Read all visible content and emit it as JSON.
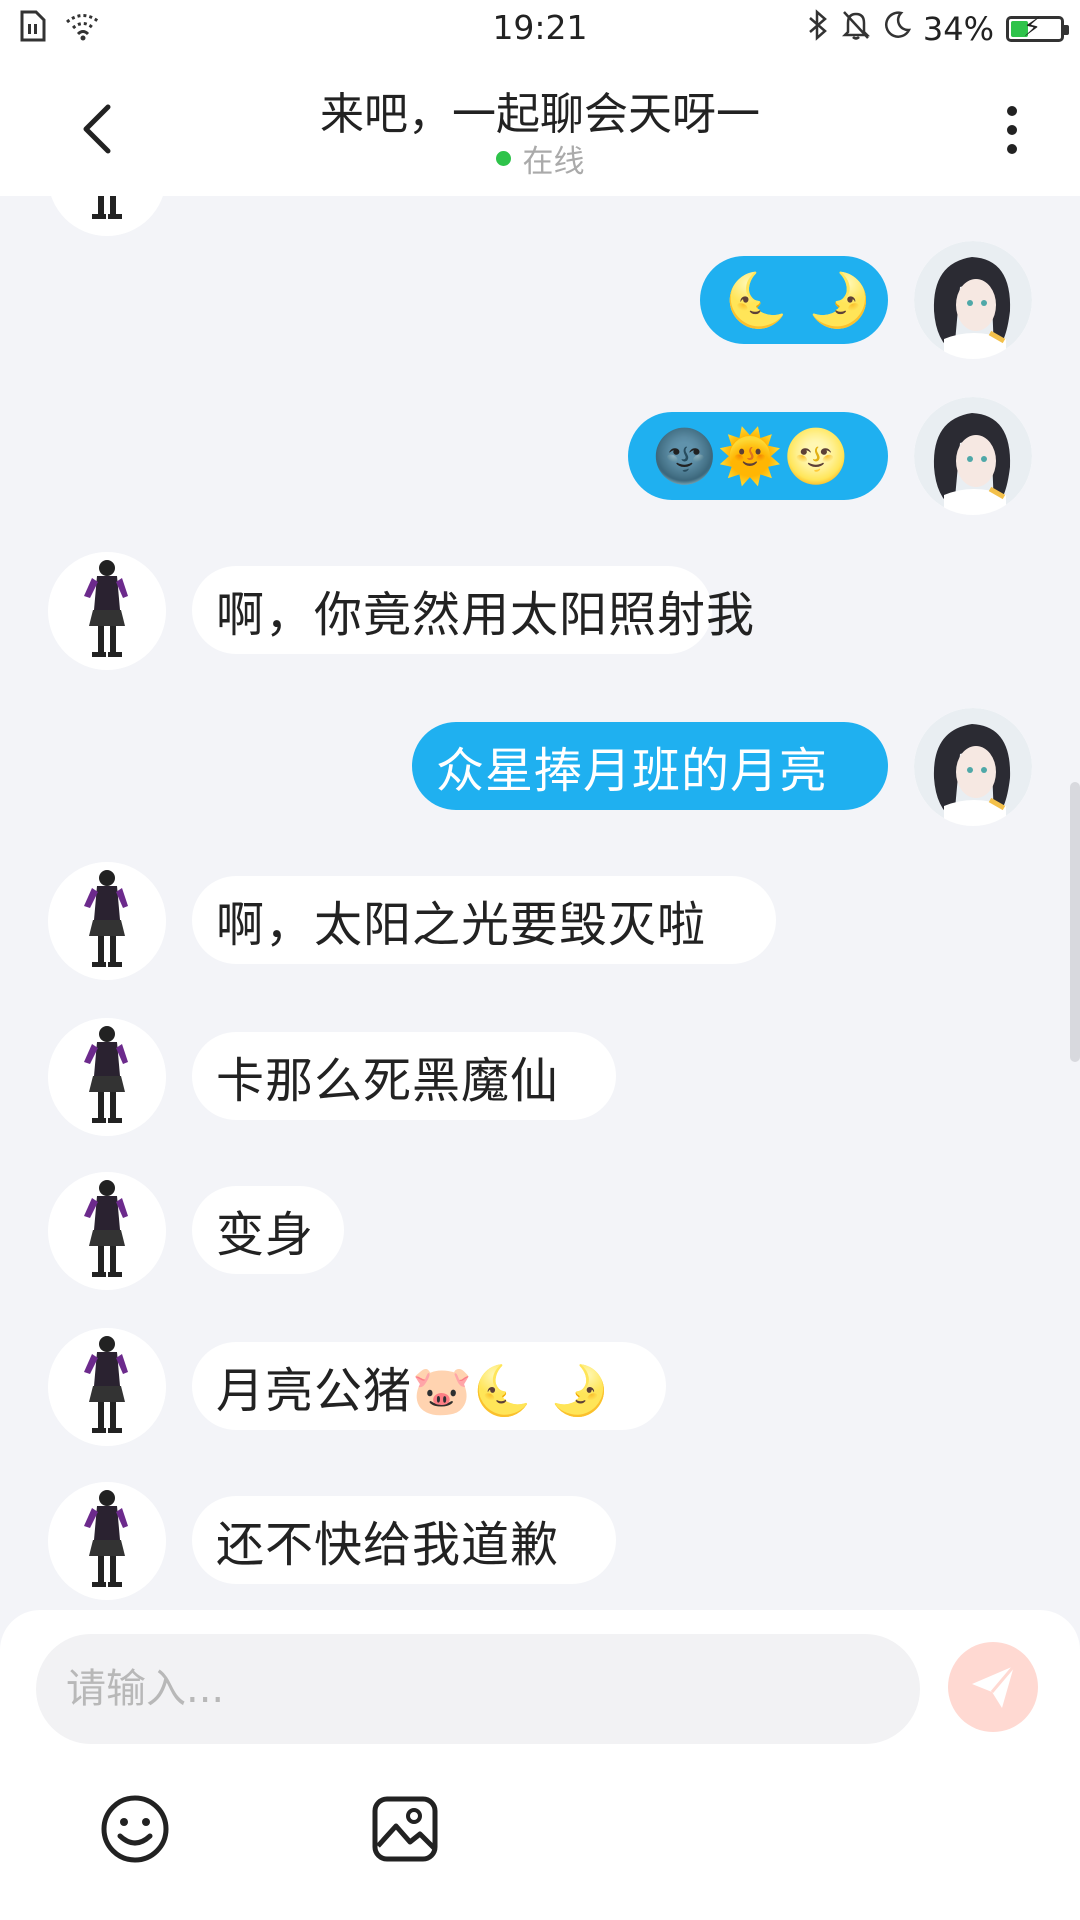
{
  "status_bar": {
    "time": "19:21",
    "battery_percent": "34%",
    "battery_level": 0.34,
    "left_icons": [
      "sim-icon",
      "wifi-icon"
    ],
    "right_icons": [
      "bluetooth-icon",
      "mute-bell-icon",
      "moon-icon",
      "battery-icon"
    ]
  },
  "header": {
    "title": "来吧，一起聊会天呀一",
    "status": "在线",
    "status_color": "#2ec34a"
  },
  "colors": {
    "outgoing_bubble": "#1fb0f0",
    "incoming_bubble": "#ffffff",
    "background": "#f3f4f8",
    "send_button": "#ffd9d2"
  },
  "messages": [
    {
      "side": "out",
      "text": "🌜  🌛"
    },
    {
      "side": "out",
      "text": "🌚🌞🌝"
    },
    {
      "side": "in",
      "text": "啊，你竟然用太阳照射我"
    },
    {
      "side": "out",
      "text": "众星捧月班的月亮"
    },
    {
      "side": "in",
      "text": "啊，太阳之光要毁灭啦"
    },
    {
      "side": "in",
      "text": "卡那么死黑魔仙"
    },
    {
      "side": "in",
      "text": "变身"
    },
    {
      "side": "in",
      "text": "月亮公猪🐷🌜  🌛"
    },
    {
      "side": "in",
      "text": "还不快给我道歉"
    }
  ],
  "composer": {
    "placeholder": "请输入...",
    "value": "",
    "tools": [
      "emoji-icon",
      "image-icon"
    ]
  }
}
